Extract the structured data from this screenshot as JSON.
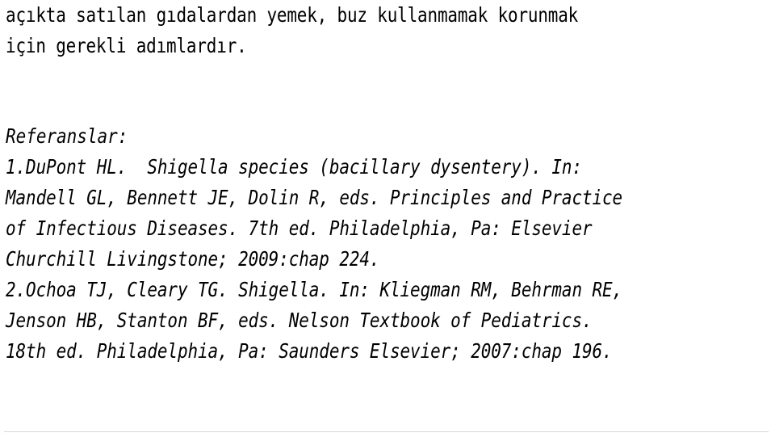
{
  "document": {
    "intro": {
      "lines": [
        "açıkta satılan gıdalardan yemek, buz kullanmamak korunmak",
        "için gerekli adımlardır."
      ]
    },
    "references": {
      "heading": "Referanslar:",
      "entries": [
        {
          "number": "1.",
          "lines": [
            "1.DuPont HL.  Shigella species (bacillary dysentery). In:",
            "Mandell GL, Bennett JE, Dolin R, eds. Principles and Practice",
            "of Infectious Diseases. 7th ed. Philadelphia, Pa: Elsevier",
            "Churchill Livingstone; 2009:chap 224."
          ]
        },
        {
          "number": "2.",
          "lines": [
            "2.Ochoa TJ, Cleary TG. Shigella. In: Kliegman RM, Behrman RE,",
            "Jenson HB, Stanton BF, eds. Nelson Textbook of Pediatrics.",
            "18th ed. Philadelphia, Pa: Saunders Elsevier; 2007:chap 196."
          ]
        }
      ]
    },
    "divider": {
      "color": "#a8a8a8"
    }
  }
}
